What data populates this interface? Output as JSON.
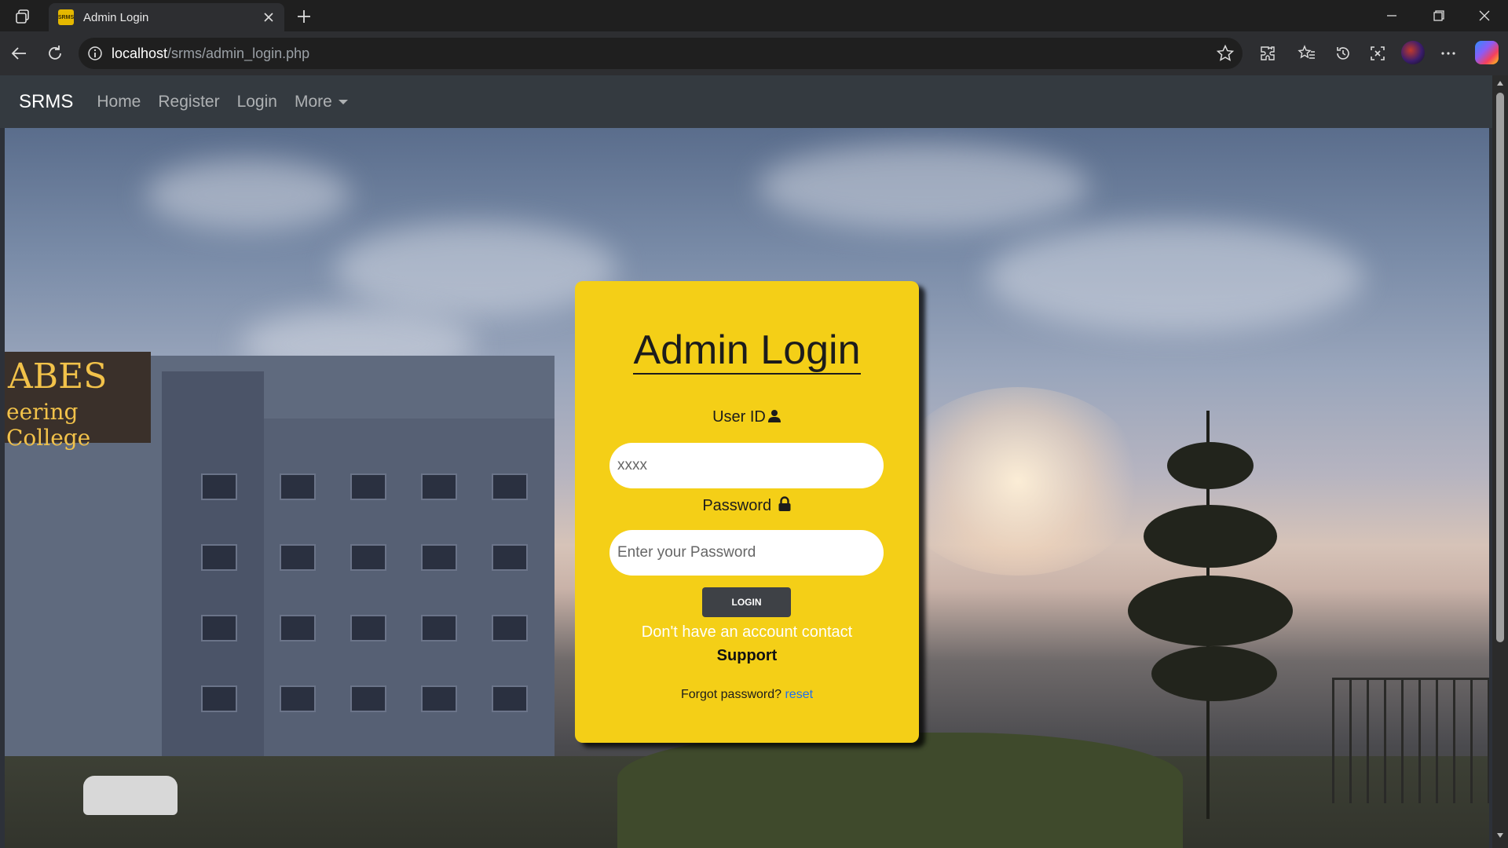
{
  "browser": {
    "tab_title": "Admin Login",
    "favicon_text": "SRMS",
    "url_host": "localhost",
    "url_path": "/srms/admin_login.php"
  },
  "nav": {
    "brand": "SRMS",
    "links": [
      "Home",
      "Register",
      "Login",
      "More"
    ]
  },
  "hero": {
    "sign_line1": "ABES",
    "sign_line2": "eering College"
  },
  "login": {
    "title": "Admin Login",
    "userid_label": "User ID",
    "userid_placeholder": "xxxx",
    "password_label": "Password",
    "password_placeholder": "Enter your Password",
    "button_label": "LOGIN",
    "no_account_text": "Don't have an account contact",
    "support_text": "Support",
    "forgot_text": "Forgot password?",
    "reset_text": "reset"
  },
  "colors": {
    "card": "#f4cf17",
    "navbar": "#343a40",
    "button": "#3e4146",
    "link": "#1e6ff0"
  }
}
